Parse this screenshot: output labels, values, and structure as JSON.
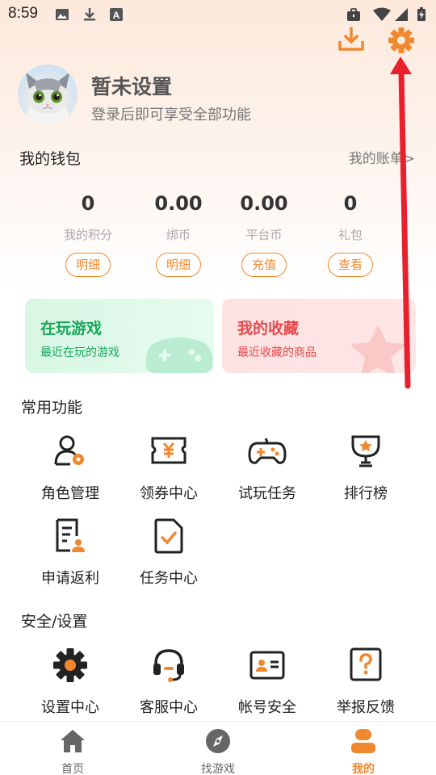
{
  "status_bar": {
    "time": "8:59"
  },
  "colors": {
    "accent": "#f0882f",
    "green": "#17a75a",
    "pink": "#e8494c",
    "annotation": "#e8202d"
  },
  "profile": {
    "name": "暂未设置",
    "subtitle": "登录后即可享受全部功能"
  },
  "wallet": {
    "title": "我的钱包",
    "account_link": "我的账单>",
    "items": [
      {
        "value": "0",
        "label": "我的积分",
        "button": "明细"
      },
      {
        "value": "0.00",
        "label": "绑币",
        "button": "明细"
      },
      {
        "value": "0.00",
        "label": "平台币",
        "button": "充值"
      },
      {
        "value": "0",
        "label": "礼包",
        "button": "查看"
      }
    ]
  },
  "cards": {
    "playing": {
      "title": "在玩游戏",
      "subtitle": "最近在玩的游戏"
    },
    "favorites": {
      "title": "我的收藏",
      "subtitle": "最近收藏的商品"
    }
  },
  "common": {
    "title": "常用功能",
    "items": [
      {
        "label": "角色管理",
        "icon": "role-manage-icon"
      },
      {
        "label": "领券中心",
        "icon": "coupon-icon"
      },
      {
        "label": "试玩任务",
        "icon": "gamepad-icon"
      },
      {
        "label": "排行榜",
        "icon": "trophy-icon"
      },
      {
        "label": "申请返利",
        "icon": "rebate-doc-icon"
      },
      {
        "label": "任务中心",
        "icon": "task-doc-icon"
      }
    ]
  },
  "security": {
    "title": "安全/设置",
    "items": [
      {
        "label": "设置中心",
        "icon": "settings-gear-icon"
      },
      {
        "label": "客服中心",
        "icon": "headset-icon"
      },
      {
        "label": "帐号安全",
        "icon": "id-card-icon"
      },
      {
        "label": "举报反馈",
        "icon": "question-icon"
      }
    ]
  },
  "tabbar": {
    "tabs": [
      {
        "label": "首页",
        "icon": "home-icon",
        "active": false
      },
      {
        "label": "找游戏",
        "icon": "compass-icon",
        "active": false
      },
      {
        "label": "我的",
        "icon": "user-icon",
        "active": true
      }
    ]
  }
}
